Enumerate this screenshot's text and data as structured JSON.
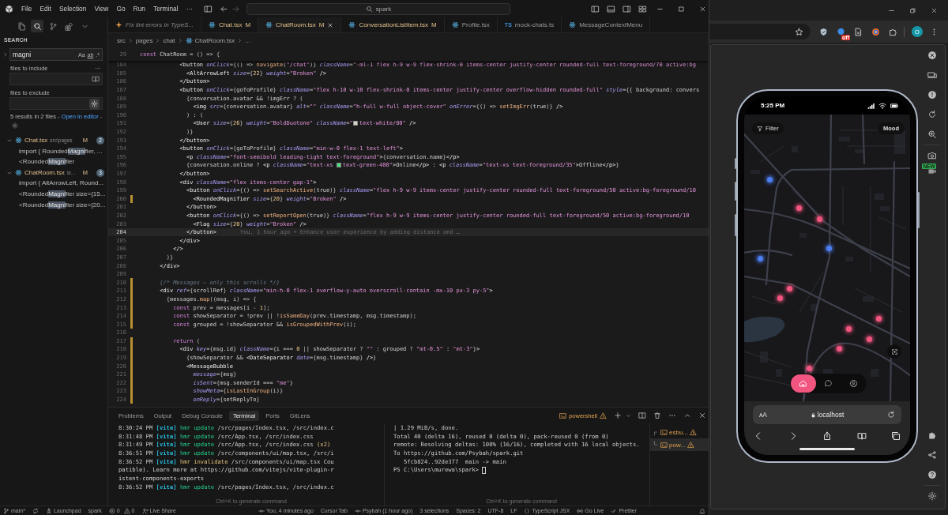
{
  "title_bar": {
    "menu": [
      "File",
      "Edit",
      "Selection",
      "View",
      "Go",
      "Run",
      "Terminal",
      "···"
    ],
    "search": "spark"
  },
  "sidebar": {
    "activity": [
      {
        "kind": "files",
        "selected": false
      },
      {
        "kind": "search",
        "selected": true
      },
      {
        "kind": "source-control",
        "selected": false
      },
      {
        "kind": "extensions",
        "selected": false
      },
      {
        "kind": "more",
        "selected": false
      }
    ],
    "heading": "SEARCH",
    "search": {
      "value": "magni",
      "options": [
        "Aa",
        "ab",
        ".*"
      ]
    },
    "include": {
      "label": "files to include",
      "more": "···"
    },
    "exclude": {
      "label": "files to exclude"
    },
    "summary": {
      "text": "5 results in 2 files - ",
      "link": "Open in editor",
      "after": " -"
    },
    "results": [
      {
        "file": "Chat.tsx",
        "path": "src\\pages",
        "status": "M",
        "count": "2",
        "expanded": true,
        "matches": [
          {
            "text": "import { Rounded",
            "match": "Magni",
            "after": "fier, ..."
          },
          {
            "text": "<Rounded",
            "match": "Magni",
            "after": "fier"
          }
        ]
      },
      {
        "file": "ChatRoom.tsx",
        "path": "sr...",
        "status": "M",
        "count": "3",
        "expanded": true,
        "matches": [
          {
            "text": "import { AltArrowLeft, Round..."
          },
          {
            "text": "<Rounded",
            "match": "Magni",
            "after": "fier size={15..."
          },
          {
            "text": "<Rounded",
            "match": "Magni",
            "after": "fier size={20..."
          }
        ]
      }
    ]
  },
  "editor": {
    "tabs": [
      {
        "kind": "chat",
        "label": "Fix lint errors in TypeS...",
        "selected": false
      },
      {
        "kind": "react",
        "label": "Chat.tsx",
        "status": "M",
        "selected": false
      },
      {
        "kind": "react",
        "label": "ChatRoom.tsx",
        "status": "M",
        "selected": true
      },
      {
        "kind": "react",
        "label": "ConversationListItem.tsx",
        "status": "M",
        "selected": false
      },
      {
        "kind": "react",
        "label": "Profile.tsx",
        "selected": false
      },
      {
        "kind": "ts",
        "icon_text": "TS",
        "label": "mock-chats.ts",
        "selected": false
      },
      {
        "kind": "react",
        "label": "MessageContextMenu",
        "selected": false
      }
    ],
    "breadcrumb": [
      {
        "kind": "folder",
        "label": "src"
      },
      {
        "kind": "folder",
        "label": "pages"
      },
      {
        "kind": "folder",
        "label": "chat"
      },
      {
        "kind": "react",
        "label": "ChatRoom.tsx"
      },
      {
        "kind": "symbol",
        "label": "..."
      }
    ],
    "sticky": {
      "number": "29",
      "text": "const ChatRoom = () => {"
    },
    "lines": [
      {
        "number": "184",
        "text": "            <button onClick={() => navigate(\"/chat\")} className=\"-ml-1 flex h-9 w-9 flex-shrink-0 items-center justify-center rounded-full text-foreground/70 active:bg",
        "current": false,
        "changed": false
      },
      {
        "number": "185",
        "text": "              <AltArrowLeft size={22} weight=\"Broken\" />",
        "current": false,
        "changed": false
      },
      {
        "number": "186",
        "text": "            </button>",
        "current": false,
        "changed": false
      },
      {
        "number": "187",
        "text": "            <button onClick={goToProfile} className=\"flex h-10 w-10 flex-shrink-0 items-center justify-center overflow-hidden rounded-full\" style={{ background: convers",
        "current": false,
        "changed": false
      },
      {
        "number": "188",
        "text": "              {conversation.avatar && !imgErr ? (",
        "current": false,
        "changed": false
      },
      {
        "number": "189",
        "text": "                <img src={conversation.avatar} alt=\"\" className=\"h-full w-full object-cover\" onError={() => setImgErr(true)} />",
        "current": false,
        "changed": false
      },
      {
        "number": "190",
        "text": "              ) : (",
        "current": false,
        "changed": false
      },
      {
        "number": "191",
        "text": "                <User size={26} weight=\"BoldDuotone\" className=\"",
        "swatch": {
          "color": "#d9d4c8"
        },
        "text_after": "text-white/80\" />",
        "current": false,
        "changed": false
      },
      {
        "number": "192",
        "text": "              )}",
        "current": false,
        "changed": false
      },
      {
        "number": "193",
        "text": "            </button>",
        "current": false,
        "changed": false
      },
      {
        "number": "194",
        "text": "            <button onClick={goToProfile} className=\"min-w-0 flex-1 text-left\">",
        "current": false,
        "changed": false
      },
      {
        "number": "195",
        "text": "              <p className=\"font-semibold leading-tight text-foreground\">{conversation.name}</p>",
        "current": false,
        "changed": false
      },
      {
        "number": "196",
        "text": "              {conversation.online ? <p className=\"text-xs ",
        "swatch": {
          "color": "#4ade80"
        },
        "text_after": "text-green-400\">Online</p> : <p className=\"text-xs text-foreground/35\">Offline</p>}",
        "current": false,
        "changed": false
      },
      {
        "number": "197",
        "text": "            </button>",
        "current": false,
        "changed": false
      },
      {
        "number": "198",
        "text": "            <div className=\"flex items-center gap-1\">",
        "current": false,
        "changed": false
      },
      {
        "number": "199",
        "text": "              <button onClick={() => setSearchActive(true)} className=\"flex h-9 w-9 items-center justify-center rounded-full text-foreground/50 active:bg-foreground/10",
        "current": false,
        "changed": false
      },
      {
        "number": "200",
        "text": "                <RoundedMagnifier size={20} weight=\"Broken\" />",
        "current": false,
        "changed": true
      },
      {
        "number": "201",
        "text": "              </button>",
        "current": false,
        "changed": false
      },
      {
        "number": "202",
        "text": "              <button onClick={() => setReportOpen(true)} className=\"flex h-9 w-9 items-center justify-center rounded-full text-foreground/50 active:bg-foreground/10",
        "current": false,
        "changed": false
      },
      {
        "number": "203",
        "text": "                <Flag size={20} weight=\"Broken\" />",
        "current": false,
        "changed": false
      },
      {
        "number": "204",
        "text": "              </button>",
        "blame": "You, 1 hour ago • Enhance user experience by adding distance and …",
        "current": true,
        "changed": false
      },
      {
        "number": "205",
        "text": "            </div>",
        "current": false,
        "changed": false
      },
      {
        "number": "206",
        "text": "          </>",
        "current": false,
        "changed": false
      },
      {
        "number": "207",
        "text": "        )}",
        "current": false,
        "changed": false
      },
      {
        "number": "208",
        "text": "      </div>",
        "current": false,
        "changed": false
      },
      {
        "number": "209",
        "current": false,
        "changed": false
      },
      {
        "number": "210",
        "text": "      {/* Messages — only this scrolls */}",
        "current": false,
        "changed": true
      },
      {
        "number": "211",
        "text": "      <div ref={scrollRef} className=\"min-h-0 flex-1 overflow-y-auto overscroll-contain -mx-10 px-3 py-5\">",
        "current": false,
        "changed": true
      },
      {
        "number": "212",
        "text": "        {messages.map((msg, i) => {",
        "current": false,
        "changed": true
      },
      {
        "number": "213",
        "text": "          const prev = messages[i - 1];",
        "current": false,
        "changed": true
      },
      {
        "number": "214",
        "text": "          const showSeparator = !prev || !isSameDay(prev.timestamp, msg.timestamp);",
        "current": false,
        "changed": true
      },
      {
        "number": "215",
        "text": "          const grouped = !showSeparator && isGroupedWithPrev(i);",
        "current": false,
        "changed": true
      },
      {
        "number": "216",
        "current": false,
        "changed": false
      },
      {
        "number": "217",
        "text": "          return (",
        "current": false,
        "changed": true
      },
      {
        "number": "218",
        "text": "            <div key={msg.id} className={i === 0 || showSeparator ? \"\" : grouped ? \"mt-0.5\" : \"mt-3\"}>",
        "current": false,
        "changed": true
      },
      {
        "number": "219",
        "text": "              {showSeparator && <DateSeparator date={msg.timestamp} />}",
        "current": false,
        "changed": true
      },
      {
        "number": "220",
        "text": "              <MessageBubble",
        "current": false,
        "changed": true
      },
      {
        "number": "221",
        "text": "                message={msg}",
        "current": false,
        "changed": true
      },
      {
        "number": "222",
        "text": "                isSent={msg.senderId === \"me\"}",
        "current": false,
        "changed": true
      },
      {
        "number": "223",
        "text": "                showMeta={isLastInGroup(i)}",
        "current": false,
        "changed": true
      },
      {
        "number": "224",
        "text": "                onReply={setReplyTo}",
        "current": false,
        "changed": true
      }
    ]
  },
  "panel": {
    "tabs": [
      {
        "label": "Problems",
        "selected": false
      },
      {
        "label": "Output",
        "selected": false
      },
      {
        "label": "Debug Console",
        "selected": false
      },
      {
        "label": "Terminal",
        "selected": true
      },
      {
        "label": "Ports",
        "selected": false
      },
      {
        "label": "GitLens",
        "selected": false
      }
    ],
    "shell": "powershell",
    "left_lines": [
      {
        "time": "8:30:24 PM",
        "tag": "[vite]",
        "action": "hmr update",
        "kind": "update",
        "text": "/src/pages/Index.tsx, /src/index.c"
      },
      {
        "time": "8:31:48 PM",
        "tag": "[vite]",
        "action": "hmr update",
        "kind": "update",
        "text": "/src/App.tsx, /src/index.css"
      },
      {
        "time": "8:31:49 PM",
        "tag": "[vite]",
        "action": "hmr update",
        "kind": "update",
        "text": "/src/App.tsx, /src/index.css",
        "count": "(x2)"
      },
      {
        "time": "8:36:51 PM",
        "tag": "[vite]",
        "action": "hmr update",
        "kind": "update",
        "text": "/src/components/ui/map.tsx, /src/i"
      },
      {
        "time": "8:36:52 PM",
        "tag": "[vite]",
        "action": "hmr invalidate",
        "kind": "invalidate",
        "text": "/src/components/ui/map.tsx Cou"
      },
      {
        "kind": "plain",
        "text": "patible). Learn more at https://github.com/vitejs/vite-plugin-r"
      },
      {
        "kind": "plain",
        "text": "istent-components-exports"
      },
      {
        "time": "8:36:52 PM",
        "tag": "[vite]",
        "action": "hmr update",
        "kind": "update",
        "text": "/src/pages/Index.tsx, /src/index.c"
      }
    ],
    "left_hint": "Ctrl+K to generate command",
    "right_lines": [
      "| 1.29 MiB/s, done.",
      "Total 40 (delta 16), reused 0 (delta 0), pack-reused 0 (from 0)",
      "remote: Resolving deltas: 100% (16/16), completed with 16 local objects.",
      "To https://github.com/Psybah/spark.git",
      "   5fcb824..92de377  main -> main"
    ],
    "prompt": "PS C:\\Users\\murewa\\spark>",
    "right_hint": "Ctrl+K to generate command",
    "terminals": [
      {
        "label": "esbu...",
        "selected": false
      },
      {
        "label": "pow...",
        "selected": true
      }
    ]
  },
  "status_bar": {
    "left": [
      {
        "kind": "branch",
        "text": "main*"
      },
      {
        "kind": "sync"
      },
      {
        "kind": "rocket",
        "text": "Launchpad"
      },
      {
        "kind": "plain",
        "text": "spark"
      },
      {
        "kind": "problems",
        "errors": "0",
        "warnings": "0"
      },
      {
        "kind": "live-share",
        "text": "Live Share"
      }
    ],
    "right": [
      {
        "kind": "commit",
        "text": "You, 4 minutes ago"
      },
      {
        "kind": "plain",
        "text": "Cursor Tab"
      },
      {
        "kind": "commit",
        "text": "Psybah (1 hour ago)"
      },
      {
        "kind": "plain",
        "text": "3 selections"
      },
      {
        "kind": "plain",
        "text": "Spaces: 2"
      },
      {
        "kind": "plain",
        "text": "UTF-8"
      },
      {
        "kind": "plain",
        "text": "LF"
      },
      {
        "kind": "braces",
        "text": "TypeScript JSX"
      },
      {
        "kind": "broadcast",
        "text": "Go Live"
      },
      {
        "kind": "check",
        "text": "Prettier"
      },
      {
        "kind": "bell"
      }
    ]
  },
  "browser": {
    "extension_badge": "off",
    "profile_initial": "O",
    "devtools_badge": "NEW",
    "phone": {
      "time": "5:25 PM",
      "map": {
        "filter": "Filter",
        "mood": "Mood",
        "pins": [
          {
            "color": "#4d7ef0"
          },
          {
            "color": "#f2557f"
          },
          {
            "color": "#f2557f"
          },
          {
            "color": "#4d7ef0"
          },
          {
            "color": "#4d7ef0"
          },
          {
            "color": "#f2557f"
          },
          {
            "color": "#f2557f"
          },
          {
            "color": "#f2557f"
          },
          {
            "color": "#f2557f"
          },
          {
            "color": "#f2557f"
          },
          {
            "color": "#f2557f"
          },
          {
            "color": "#f2557f"
          }
        ]
      },
      "nav": [
        {
          "kind": "home",
          "selected": true
        },
        {
          "kind": "chat",
          "selected": false
        },
        {
          "kind": "profile",
          "selected": false
        }
      ],
      "safari": {
        "text_size": "AA",
        "url": "localhost"
      }
    }
  }
}
